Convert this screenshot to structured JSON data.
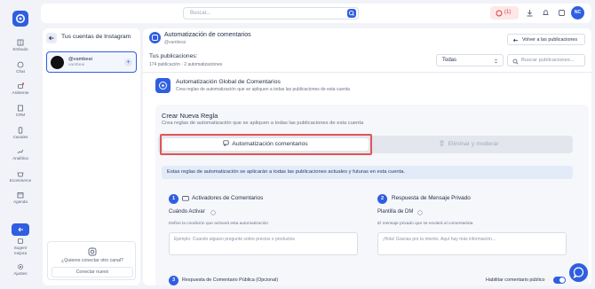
{
  "colors": {
    "accent": "#2f5fe0",
    "alert": "#d93636",
    "highlight_box": "#e05555"
  },
  "sidebar": {
    "items": [
      {
        "label": "Embudo",
        "icon": "grid-icon"
      },
      {
        "label": "Chat",
        "icon": "chat-bubble-icon"
      },
      {
        "label": "Asistente",
        "icon": "assistant-icon"
      },
      {
        "label": "CRM",
        "icon": "clipboard-icon"
      },
      {
        "label": "Canales",
        "icon": "phone-icon"
      },
      {
        "label": "Analítica",
        "icon": "chart-icon"
      },
      {
        "label": "Ecommerce",
        "icon": "basket-icon"
      },
      {
        "label": "Agenda",
        "icon": "calendar-icon"
      },
      {
        "label": "Sugerir mejora",
        "icon": "suggest-icon"
      },
      {
        "label": "Ajustes",
        "icon": "gear-icon"
      }
    ]
  },
  "topbar": {
    "search_placeholder": "Buscar...",
    "notif_count": "(1)",
    "avatar_initials": "NC"
  },
  "accounts": {
    "title": "Tus cuentas de Instagram",
    "selected": {
      "name": "@vambeai",
      "sub": "vambeai"
    },
    "connect_question": "¿Quieres conectar otro canal?",
    "connect_button": "Conectar nuevo"
  },
  "main": {
    "header_title": "Automatización de comentarios",
    "header_sub": "@vambeai",
    "back_button": "Volver a las publicaciones",
    "pubs_title": "Tus publicaciones:",
    "pubs_sub": "174 publicación · 2 automatizaciones",
    "filter_value": "Todas",
    "search_placeholder": "Buscar publicaciones...",
    "global_title": "Automatización Global de Comentarios",
    "global_sub": "Crea reglas de automatización que se apliquen a todas las publicaciones de esta cuenta",
    "rule_title": "Crear Nueva Regla",
    "rule_sub": "Crea reglas de automatización que se apliquen a todas las publicaciones de esta cuenta",
    "tab_active": "Automatización comentarios",
    "tab_inactive": "Eliminar y moderar",
    "info_text": "Estas reglas de automatización se aplicarán a todas las publicaciones actuales y futuras en esta cuenta.",
    "col1": {
      "step": "1",
      "title": "Activadores de Comentarios",
      "field_label": "Cuándo Activar",
      "field_desc": "Define la condición que activará esta automatización",
      "placeholder": "Ejemplo: Cuando alguien pregunte sobre precios o productos"
    },
    "col2": {
      "step": "2",
      "title": "Respuesta de Mensaje Privado",
      "field_label": "Plantilla de DM",
      "field_desc": "El mensaje privado que se enviará al comentarista",
      "placeholder": "¡Hola! Gracias por tu interés. Aquí hay más información..."
    },
    "bottom_left": "Respuesta de Comentario Pública (Opcional)",
    "bottom_right": "Habilitar comentario público"
  }
}
